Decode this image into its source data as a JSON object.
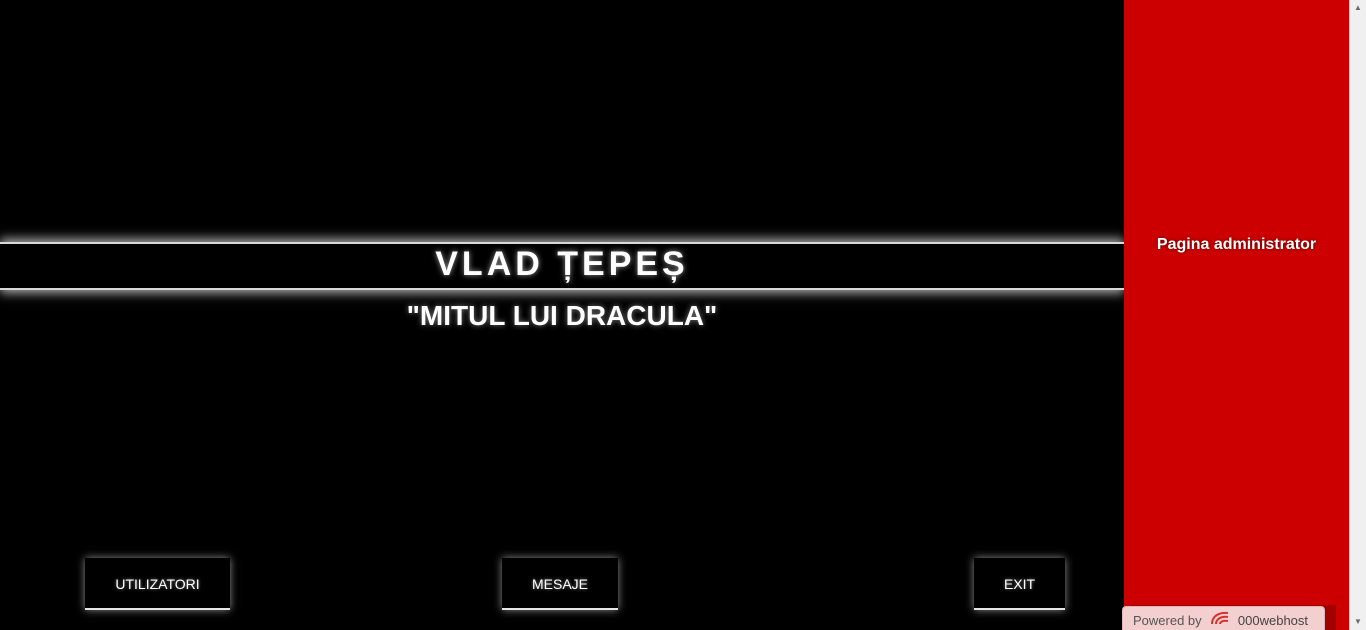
{
  "main": {
    "title": "VLAD ȚEPEȘ",
    "subtitle": "\"MITUL LUI DRACULA\"",
    "buttons": {
      "utilizatori": "UTILIZATORI",
      "mesaje": "MESAJE",
      "exit": "EXIT"
    }
  },
  "sidebar": {
    "title": "Pagina administrator"
  },
  "footer_badge": {
    "powered_label": "Powered by",
    "host_name": "000webhost",
    "logo_icon": "000webhost-logo-icon"
  },
  "colors": {
    "background": "#000000",
    "sidebar": "#cc0000",
    "text": "#ffffff"
  }
}
